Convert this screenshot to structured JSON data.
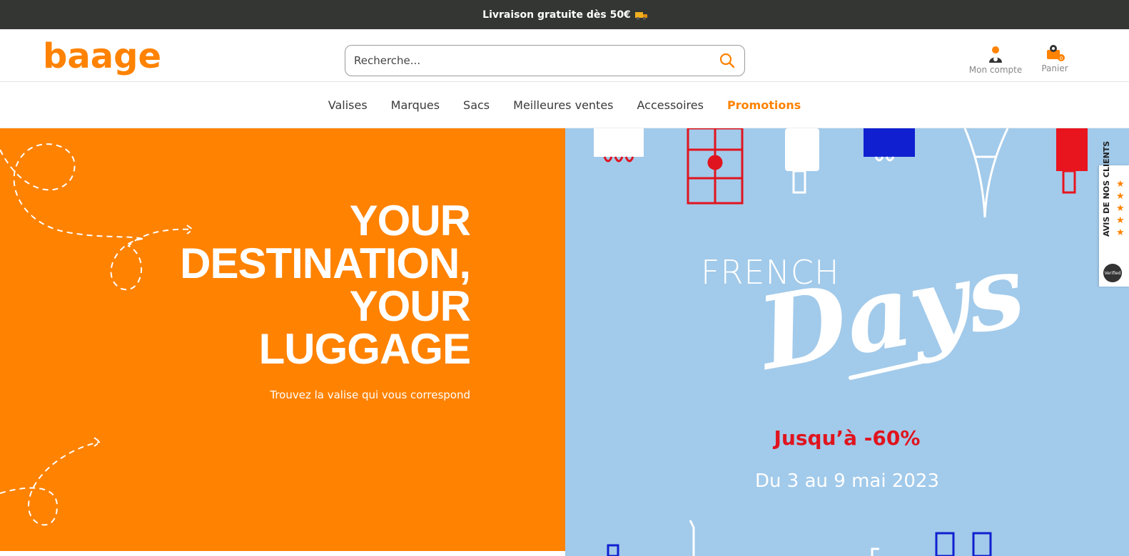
{
  "topbar": {
    "announcement": "Livraison gratuite dès 50€"
  },
  "brand": {
    "logo_text": "baage",
    "accent_color": "#ff8200"
  },
  "search": {
    "placeholder": "Recherche..."
  },
  "header": {
    "account_label": "Mon compte",
    "cart_label": "Panier",
    "cart_count": "0"
  },
  "nav": {
    "items": [
      {
        "label": "Valises"
      },
      {
        "label": "Marques"
      },
      {
        "label": "Sacs"
      },
      {
        "label": "Meilleures ventes"
      },
      {
        "label": "Accessoires"
      },
      {
        "label": "Promotions"
      }
    ]
  },
  "hero_left": {
    "headline_lines": [
      "YOUR",
      "DESTINATION,",
      "YOUR",
      "LUGGAGE"
    ],
    "subline": "Trouvez la valise qui vous correspond"
  },
  "hero_right": {
    "french": "FRENCH",
    "days": "Days",
    "promo": "Jusqu’à -60%",
    "dates": "Du 3 au 9 mai 2023"
  },
  "reviews_widget": {
    "label": "AVIS DE NOS CLIENTS",
    "stars": "★★★★★",
    "badge": "Verified"
  }
}
